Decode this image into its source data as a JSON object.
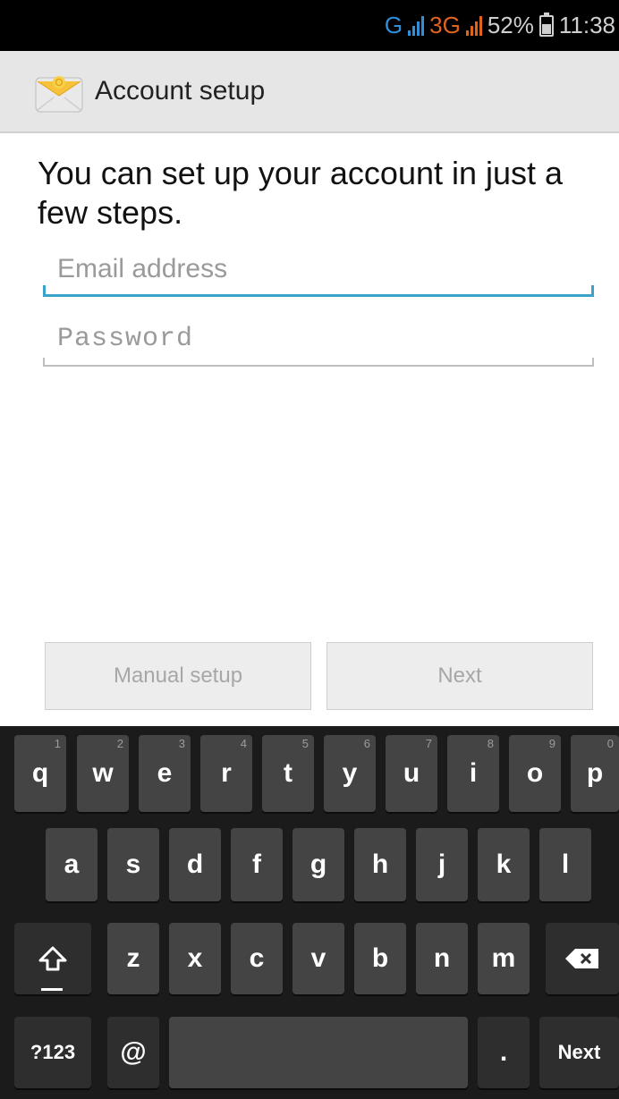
{
  "status_bar": {
    "network_1": "G",
    "network_2": "3G",
    "battery_percent": "52%",
    "time": "11:38",
    "net_color_blue": "#2f8fd8",
    "net_color_orange": "#e0641e"
  },
  "title_bar": {
    "title": "Account setup",
    "icon": "email-envelope-icon"
  },
  "content": {
    "headline": "You can set up your account in just a few steps.",
    "email_placeholder": "Email address",
    "password_placeholder": "Password",
    "focus_color": "#3aa3c9"
  },
  "buttons": {
    "manual_setup": "Manual setup",
    "next": "Next"
  },
  "keyboard": {
    "row1": [
      {
        "label": "q",
        "hint": "1"
      },
      {
        "label": "w",
        "hint": "2"
      },
      {
        "label": "e",
        "hint": "3"
      },
      {
        "label": "r",
        "hint": "4"
      },
      {
        "label": "t",
        "hint": "5"
      },
      {
        "label": "y",
        "hint": "6"
      },
      {
        "label": "u",
        "hint": "7"
      },
      {
        "label": "i",
        "hint": "8"
      },
      {
        "label": "o",
        "hint": "9"
      },
      {
        "label": "p",
        "hint": "0"
      }
    ],
    "row2": [
      "a",
      "s",
      "d",
      "f",
      "g",
      "h",
      "j",
      "k",
      "l"
    ],
    "row3": [
      "z",
      "x",
      "c",
      "v",
      "b",
      "n",
      "m"
    ],
    "shift_icon": "shift-arrow-icon",
    "backspace_icon": "backspace-icon",
    "symbols_label": "?123",
    "at_label": "@",
    "period_label": ".",
    "action_label": "Next"
  }
}
